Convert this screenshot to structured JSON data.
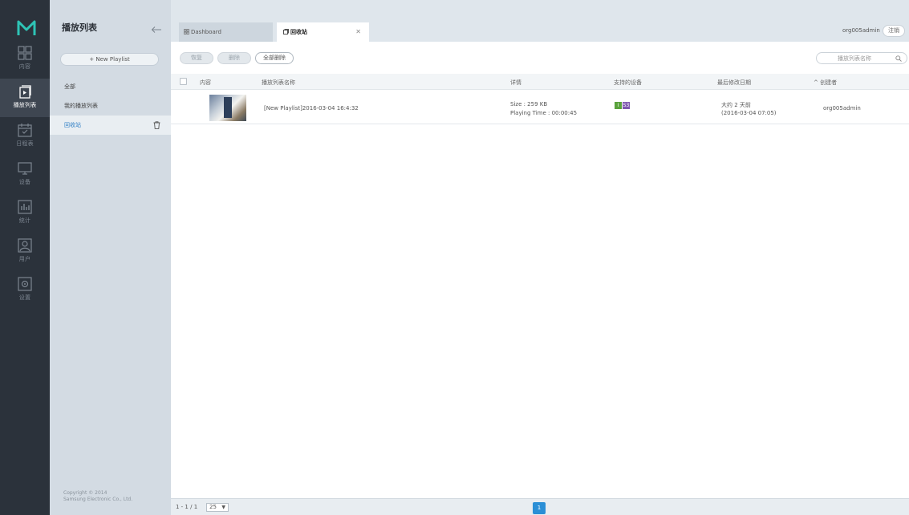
{
  "rail": {
    "items": [
      {
        "label": "内容",
        "icon": "content-grid-icon"
      },
      {
        "label": "播放列表",
        "icon": "playlist-icon",
        "active": true
      },
      {
        "label": "日程表",
        "icon": "schedule-icon"
      },
      {
        "label": "设备",
        "icon": "device-icon"
      },
      {
        "label": "统计",
        "icon": "statistics-icon"
      },
      {
        "label": "用户",
        "icon": "user-icon"
      },
      {
        "label": "设置",
        "icon": "settings-icon"
      }
    ]
  },
  "panel": {
    "title": "播放列表",
    "new_button": "+ New Playlist",
    "items": [
      {
        "label": "全部"
      },
      {
        "label": "我的播放列表"
      },
      {
        "label": "回收站",
        "selected": true
      }
    ],
    "copyright_line1": "Copyright © 2014",
    "copyright_line2": "Samsung Electronic Co., Ltd."
  },
  "tabs": {
    "dashboard": "Dashboard",
    "recycle": "回收站"
  },
  "header": {
    "username": "org005admin",
    "logout": "注销"
  },
  "toolbar": {
    "restore": "恢复",
    "delete": "删除",
    "delete_all": "全部删除",
    "search_placeholder": "播放列表名称"
  },
  "table": {
    "headers": {
      "content": "内容",
      "name": "播放列表名称",
      "details": "详情",
      "devices": "支持的设备",
      "modified": "最后修改日期",
      "creator": "创建者"
    },
    "rows": [
      {
        "name": "[New Playlist]2016-03-04 16:4:32",
        "size": "Size : 259 KB",
        "playing_time": "Playing Time : 00:00:45",
        "device_badges": [
          {
            "text": "I",
            "color": "#5aa23c"
          },
          {
            "text": "S3",
            "color": "#7f58b0"
          }
        ],
        "modified_relative": "大约 2 天前",
        "modified_date": "(2016-03-04 07:05)",
        "creator": "org005admin"
      }
    ]
  },
  "footer": {
    "range": "1 - 1 / 1",
    "page_size": "25",
    "current_page": "1"
  },
  "colors": {
    "accent": "#2b8fd6",
    "rail_bg": "#2b323b",
    "logo_teal": "#2ec4b6"
  }
}
